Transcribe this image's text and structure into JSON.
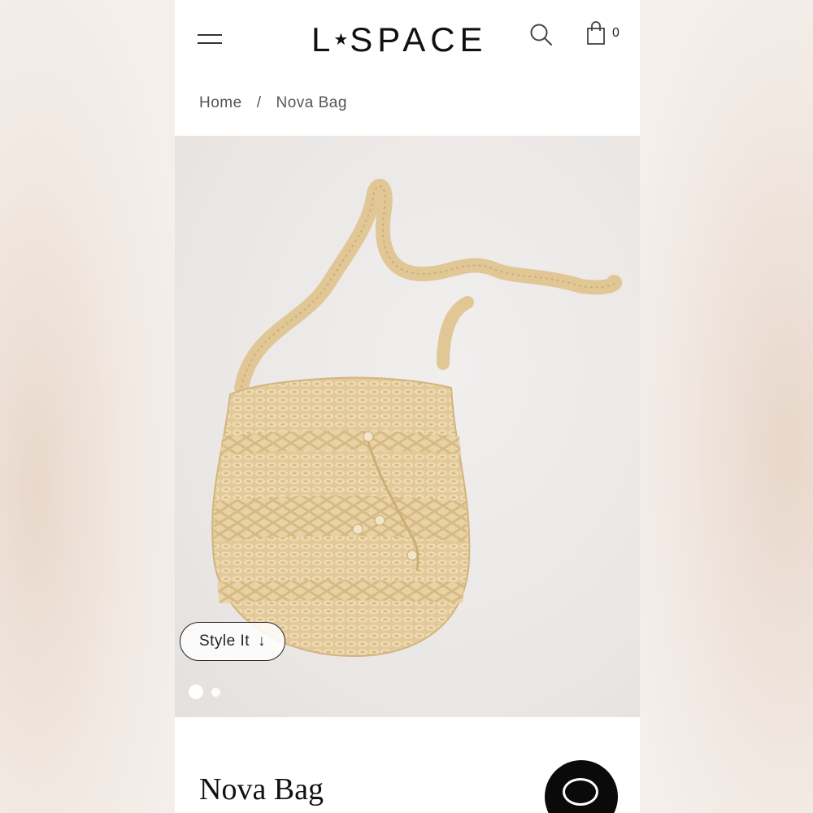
{
  "header": {
    "logo_text": "L★SPACE",
    "logo_left": "L",
    "logo_star": "★",
    "logo_right": "SPACE",
    "cart_count": "0",
    "icons": [
      "menu-icon",
      "search-icon",
      "shopping-bag-icon"
    ]
  },
  "breadcrumb": {
    "home": "Home",
    "separator": "/",
    "current": "Nova Bag"
  },
  "gallery": {
    "style_button_label": "Style It",
    "style_button_arrow": "↓",
    "image_count": 2,
    "active_index": 0
  },
  "product": {
    "title": "Nova Bag"
  },
  "colors": {
    "accent": "#111111",
    "bag": "#e6cfa1"
  }
}
